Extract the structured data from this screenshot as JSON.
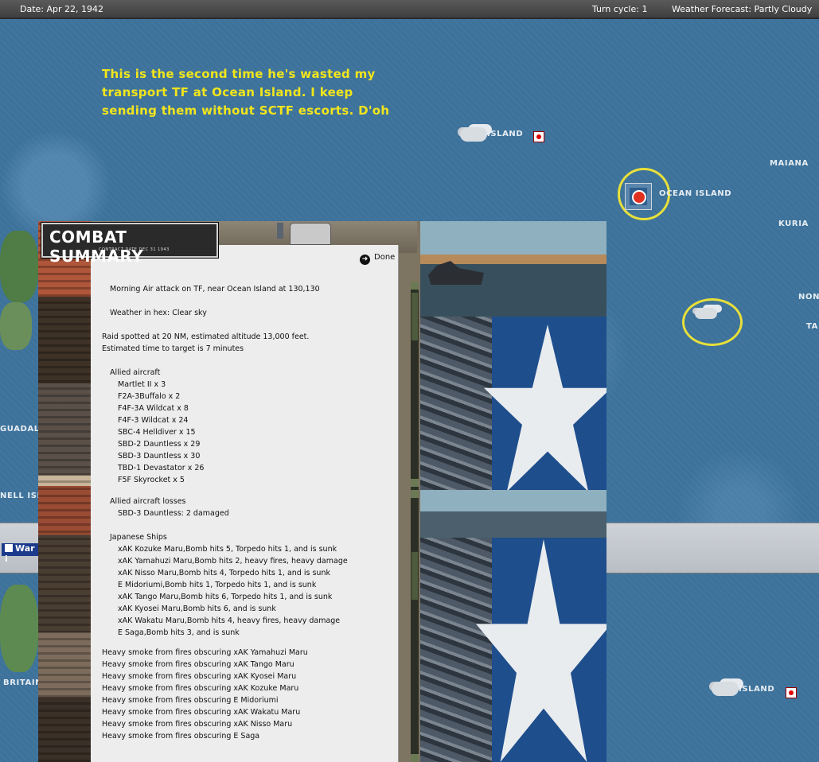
{
  "topbar": {
    "date": "Date: Apr 22, 1942",
    "turn": "Turn cycle: 1",
    "weather": "Weather Forecast: Partly Cloudy"
  },
  "annotation": [
    "This is the second time he's wasted my",
    "transport TF at Ocean Island.  I keep",
    "sending them without SCTF escorts.  D'oh"
  ],
  "map_labels": {
    "island1": "ISLAND",
    "ocean_island": "OCEAN ISLAND",
    "maiana": "MAIANA",
    "kuria": "KURIA",
    "nono": "NONO",
    "ta": "TA",
    "guadal": "GUADAL",
    "nell_isla": "NELL ISLA",
    "britain": "BRITAIN",
    "island2": "ISLAND"
  },
  "strip": {
    "title": "War i"
  },
  "combat": {
    "header": "COMBAT SUMMARY",
    "subheader": "CONTRACT DATE DEC 31 1943",
    "done": "Done",
    "lines": [
      "Morning Air attack on TF, near Ocean Island at 130,130",
      "Weather in hex: Clear sky",
      "Raid spotted at 20 NM, estimated altitude 13,000 feet.",
      "Estimated time to target is 7 minutes",
      "Allied aircraft",
      "Martlet II x 3",
      "F2A-3Buffalo x 2",
      "F4F-3A Wildcat x 8",
      "F4F-3 Wildcat x 24",
      "SBC-4 Helldiver x 15",
      "SBD-2 Dauntless x 29",
      "SBD-3 Dauntless x 30",
      "TBD-1 Devastator x 26",
      "F5F Skyrocket x 5",
      "Allied aircraft losses",
      "SBD-3 Dauntless: 2 damaged",
      "Japanese Ships",
      "xAK Kozuke Maru,Bomb hits 5, Torpedo hits 1, and is sunk",
      "xAK Yamahuzi Maru,Bomb hits 2,  heavy fires,  heavy damage",
      "xAK Nisso Maru,Bomb hits 4, Torpedo hits 1, and is sunk",
      "E Midoriumi,Bomb hits 1, Torpedo hits 1, and is sunk",
      "xAK Tango Maru,Bomb hits 6, Torpedo hits 1, and is sunk",
      "xAK Kyosei Maru,Bomb hits 6, and is sunk",
      "xAK Wakatu Maru,Bomb hits 4,  heavy fires,  heavy damage",
      "E Saga,Bomb hits 3, and is sunk",
      "Heavy smoke from fires obscuring xAK Yamahuzi Maru",
      "Heavy smoke from fires obscuring xAK Tango Maru",
      "Heavy smoke from fires obscuring xAK Kyosei Maru",
      "Heavy smoke from fires obscuring xAK Kozuke Maru",
      "Heavy smoke from fires obscuring E Midoriumi",
      "Heavy smoke from fires obscuring xAK Wakatu Maru",
      "Heavy smoke from fires obscuring xAK Nisso Maru",
      "Heavy smoke from fires obscuring E Saga"
    ]
  },
  "colors": {
    "ocean": "#3d729b",
    "annotation": "#f2e51c",
    "ring": "#e8e03a"
  }
}
